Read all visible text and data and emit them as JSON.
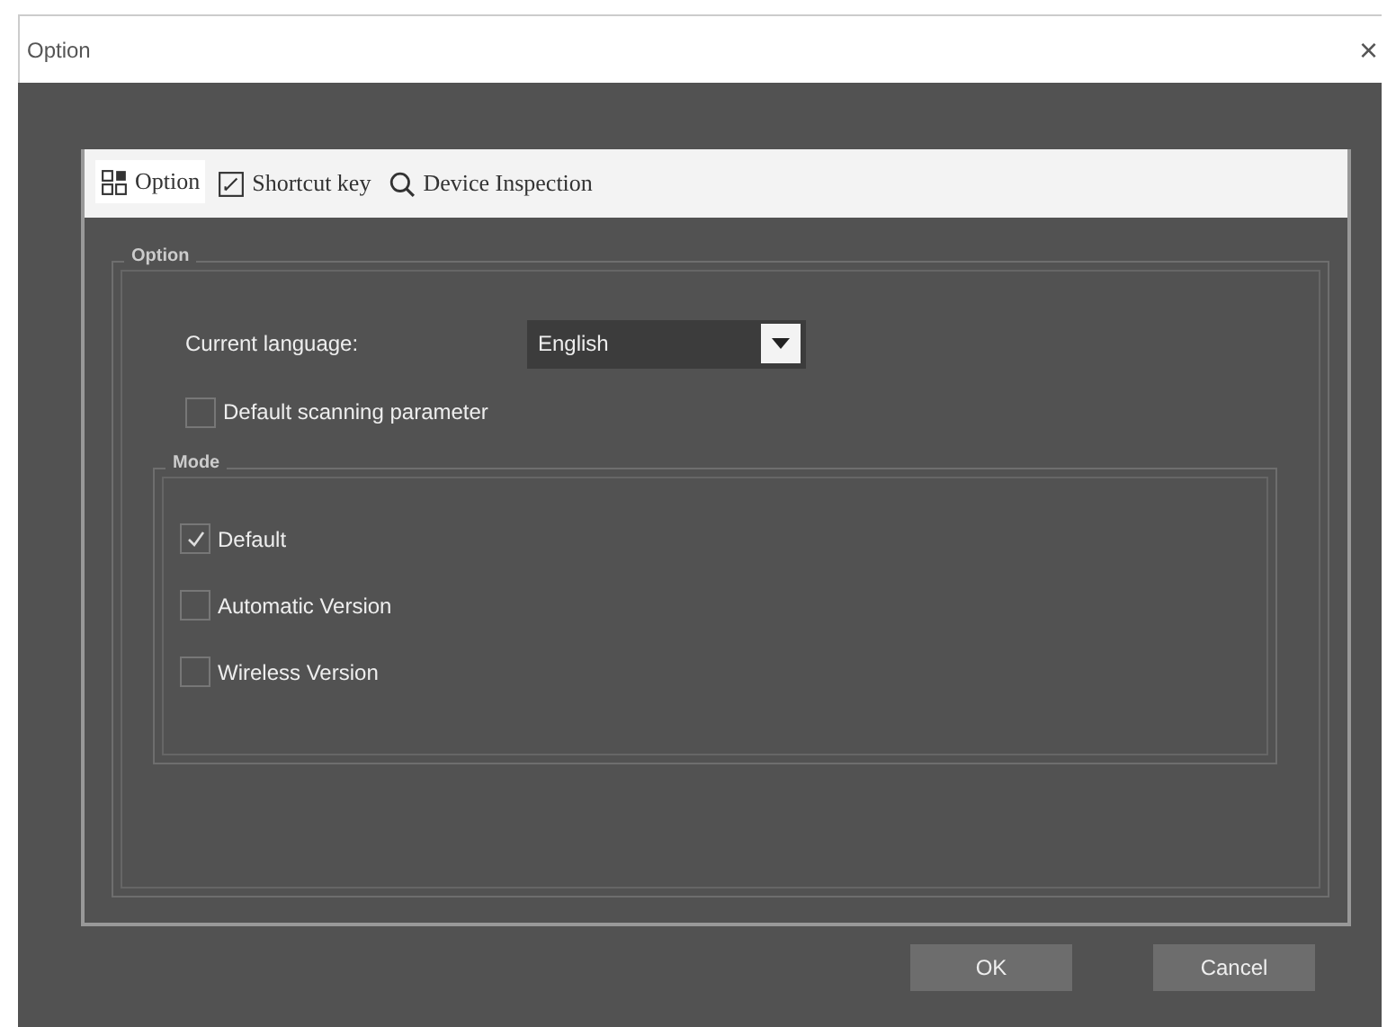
{
  "window": {
    "title": "Option",
    "close": "×"
  },
  "tabs": [
    {
      "label": "Option",
      "selected": true
    },
    {
      "label": "Shortcut key",
      "selected": false
    },
    {
      "label": "Device Inspection",
      "selected": false
    }
  ],
  "option_group": {
    "title": "Option",
    "language_label": "Current language:",
    "language": "English",
    "default_scan": {
      "label": "Default scanning parameter",
      "checked": false
    }
  },
  "mode_group": {
    "title": "Mode",
    "items": [
      {
        "label": "Default",
        "checked": true
      },
      {
        "label": "Automatic Version",
        "checked": false
      },
      {
        "label": "Wireless Version",
        "checked": false
      }
    ]
  },
  "buttons": [
    "OK",
    "Cancel"
  ]
}
